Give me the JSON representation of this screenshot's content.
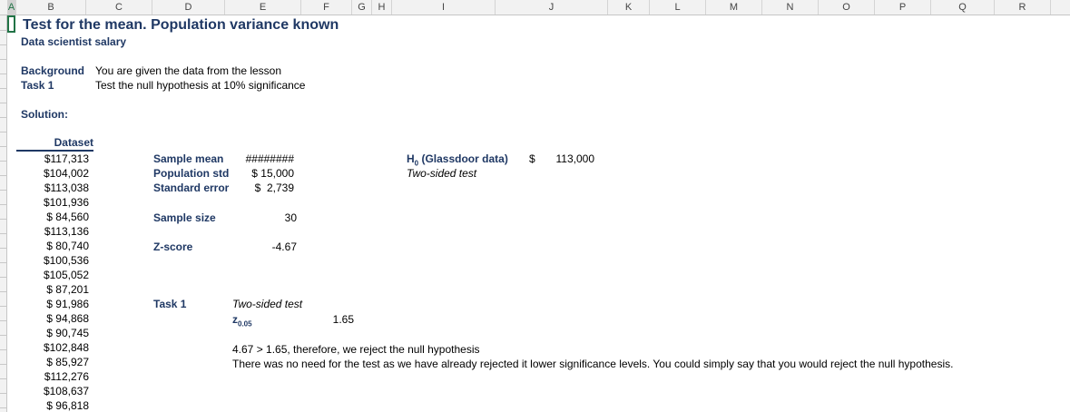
{
  "columns": [
    "A",
    "B",
    "C",
    "D",
    "E",
    "F",
    "G",
    "H",
    "I",
    "J",
    "K",
    "L",
    "M",
    "N",
    "O",
    "P",
    "Q",
    "R"
  ],
  "title": "Test for the mean. Population variance known",
  "subtitle": "Data scientist salary",
  "background_label": "Background",
  "background_text": "You are given the data from the lesson",
  "task1_label": "Task 1",
  "task1_text": "Test the null hypothesis at 10% significance",
  "solution_label": "Solution:",
  "dataset": {
    "header": "Dataset",
    "values": [
      "$117,313",
      "$104,002",
      "$113,038",
      "$101,936",
      "$ 84,560",
      "$113,136",
      "$ 80,740",
      "$100,536",
      "$105,052",
      "$ 87,201",
      "$ 91,986",
      "$ 94,868",
      "$ 90,745",
      "$102,848",
      "$ 85,927",
      "$112,276",
      "$108,637",
      "$ 96,818"
    ]
  },
  "stats": {
    "sample_mean_label": "Sample mean",
    "sample_mean_value": "########",
    "population_std_label": "Population std",
    "population_std_value": "$ 15,000",
    "standard_error_label": "Standard error",
    "standard_error_value": "$  2,739",
    "sample_size_label": "Sample size",
    "sample_size_value": "30",
    "zscore_label": "Z-score",
    "zscore_value": "-4.67"
  },
  "h0": {
    "label_prefix": "H",
    "label_sub": "0",
    "label_suffix": " (Glassdoor data)",
    "currency": "$",
    "value": "113,000",
    "test_type": "Two-sided test"
  },
  "task1_result": {
    "label": "Task 1",
    "test_type": "Two-sided test",
    "z_symbol": "z",
    "z_sub": "0.05",
    "z_value": "1.65",
    "conclusion": "4.67 > 1.65, therefore, we reject the null hypothesis",
    "note": "There was no need for the test as we have already rejected it lower significance levels. You could simply say that you would reject the null hypothesis."
  }
}
